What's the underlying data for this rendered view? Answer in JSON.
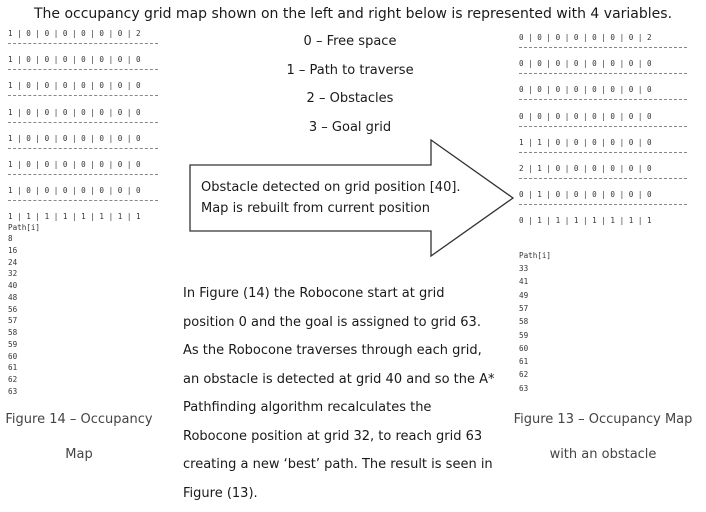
{
  "heading": "The occupancy grid map shown on the left and right below is represented with 4 variables.",
  "legend": [
    "0 – Free space",
    "1 – Path to traverse",
    "2 – Obstacles",
    "3 – Goal grid"
  ],
  "left_grid": [
    "1 | 0 | 0 | 0 | 0 | 0 | 0 | 2",
    "1 | 0 | 0 | 0 | 0 | 0 | 0 | 0",
    "1 | 0 | 0 | 0 | 0 | 0 | 0 | 0",
    "1 | 0 | 0 | 0 | 0 | 0 | 0 | 0",
    "1 | 0 | 0 | 0 | 0 | 0 | 0 | 0",
    "1 | 0 | 0 | 0 | 0 | 0 | 0 | 0",
    "1 | 0 | 0 | 0 | 0 | 0 | 0 | 0",
    "1 | 1 | 1 | 1 | 1 | 1 | 1 | 1"
  ],
  "left_path_label": "Path[i]",
  "left_path": [
    "8",
    "16",
    "24",
    "32",
    "40",
    "48",
    "56",
    "57",
    "58",
    "59",
    "60",
    "61",
    "62",
    "63"
  ],
  "right_grid": [
    "0 | 0 | 0 | 0 | 0 | 0 | 0 | 2",
    "0 | 0 | 0 | 0 | 0 | 0 | 0 | 0",
    "0 | 0 | 0 | 0 | 0 | 0 | 0 | 0",
    "0 | 0 | 0 | 0 | 0 | 0 | 0 | 0",
    "1 | 1 | 0 | 0 | 0 | 0 | 0 | 0",
    "2 | 1 | 0 | 0 | 0 | 0 | 0 | 0",
    "0 | 1 | 0 | 0 | 0 | 0 | 0 | 0",
    "0 | 1 | 1 | 1 | 1 | 1 | 1 | 1"
  ],
  "right_path_label": "Path[i]",
  "right_path": [
    "33",
    "41",
    "49",
    "57",
    "58",
    "59",
    "60",
    "61",
    "62",
    "63"
  ],
  "arrow_text": [
    "Obstacle detected on grid position [40].",
    "Map is rebuilt from current position"
  ],
  "paragraph": [
    "In Figure (14) the Robocone start at grid",
    "position 0 and the goal is assigned to grid 63.",
    "As the Robocone traverses through each grid,",
    "an obstacle is detected at grid 40 and so the A*",
    "Pathfinding algorithm recalculates the",
    "Robocone position at grid 32, to reach grid 63",
    "creating a new ‘best’ path. The result is seen in",
    "Figure (13)."
  ],
  "caption_left": [
    "Figure 14 – Occupancy",
    "Map"
  ],
  "caption_right": [
    "Figure 13 – Occupancy Map",
    "with an obstacle"
  ]
}
